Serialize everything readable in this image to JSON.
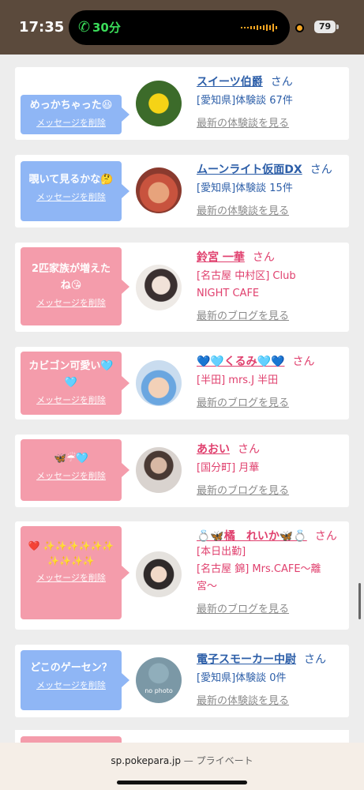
{
  "status_bar": {
    "time": "17:35",
    "call_icon": "phone-icon",
    "call_duration": "30分",
    "battery_percent": "79",
    "bg_color": "#5b4a3c"
  },
  "colors": {
    "blue_bubble": "#8fb6f5",
    "pink_bubble": "#f49cab",
    "blue_text": "#2c5ea8",
    "pink_text": "#e0406e"
  },
  "cards": [
    {
      "message": "めっかちゃった😆",
      "delete_label": "メッセージを削除",
      "name": "スイーツ伯爵",
      "honorific": "さん",
      "desc": "[愛知県]体験談 67件",
      "latest_label": "最新の体験談を見る"
    },
    {
      "message": "覗いて見るかな🤔",
      "delete_label": "メッセージを削除",
      "name": "ムーンライト仮面DX",
      "honorific": "さん",
      "desc": "[愛知県]体験談 15件",
      "latest_label": "最新の体験談を見る"
    },
    {
      "message": "2匹家族が増えたね😘",
      "delete_label": "メッセージを削除",
      "name": "鈴宮 一華",
      "honorific": "さん",
      "desc": "[名古屋 中村区] Club NIGHT CAFE",
      "latest_label": "最新のブログを見る"
    },
    {
      "message": "カビゴン可愛い🩵🩵",
      "delete_label": "メッセージを削除",
      "name": "💙🩵くるみ🩵💙",
      "honorific": "さん",
      "desc": "[半田] mrs.J 半田",
      "latest_label": "最新のブログを見る"
    },
    {
      "message": "🦋☔🩵",
      "delete_label": "メッセージを削除",
      "name": "あおい",
      "honorific": "さん",
      "desc": "[国分町] 月華",
      "latest_label": "最新のブログを見る"
    },
    {
      "message": "❤️ ✨✨✨✨✨✨ ✨✨✨✨",
      "delete_label": "メッセージを削除",
      "name": "💍🦋橘　れいか🦋💍",
      "honorific": "さん",
      "extra": "[本日出勤]",
      "desc": "[名古屋 錦] Mrs.CAFE〜離宮〜",
      "latest_label": "最新のブログを見る"
    },
    {
      "message": "どこのゲーセン？",
      "delete_label": "メッセージを削除",
      "name": "電子スモーカー中尉",
      "honorific": "さん",
      "desc": "[愛知県]体験談 0件",
      "latest_label": "最新の体験談を見る",
      "avatar_text": "no photo"
    }
  ],
  "bottom_bar": {
    "domain": "sp.pokepara.jp",
    "mode": "— プライベート"
  }
}
